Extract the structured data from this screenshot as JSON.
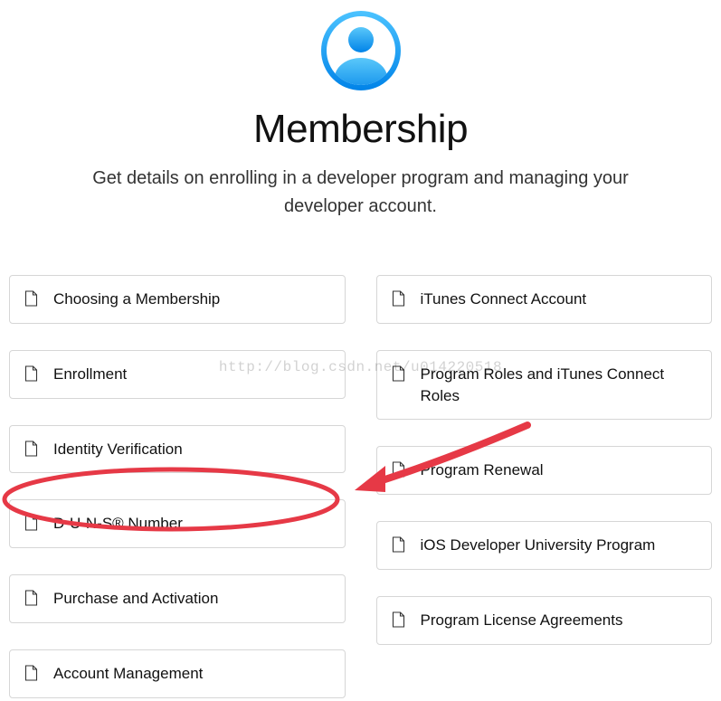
{
  "header": {
    "title": "Membership",
    "subtitle": "Get details on enrolling in a developer program and managing your developer account."
  },
  "left_column": [
    {
      "label": "Choosing a Membership",
      "name": "choosing-membership"
    },
    {
      "label": "Enrollment",
      "name": "enrollment"
    },
    {
      "label": "Identity Verification",
      "name": "identity-verification"
    },
    {
      "label": "D-U-N-S® Number",
      "name": "duns-number"
    },
    {
      "label": "Purchase and Activation",
      "name": "purchase-activation"
    },
    {
      "label": "Account Management",
      "name": "account-management"
    }
  ],
  "right_column": [
    {
      "label": "iTunes Connect Account",
      "name": "itunes-connect-account"
    },
    {
      "label": "Program Roles and iTunes Connect Roles",
      "name": "program-roles"
    },
    {
      "label": "Program Renewal",
      "name": "program-renewal"
    },
    {
      "label": "iOS Developer University Program",
      "name": "ios-university"
    },
    {
      "label": "Program License Agreements",
      "name": "license-agreements"
    }
  ],
  "watermark": "http://blog.csdn.net/u014220518",
  "annotation": {
    "ellipse_stroke": "#e63946",
    "arrow_stroke": "#e63946"
  }
}
